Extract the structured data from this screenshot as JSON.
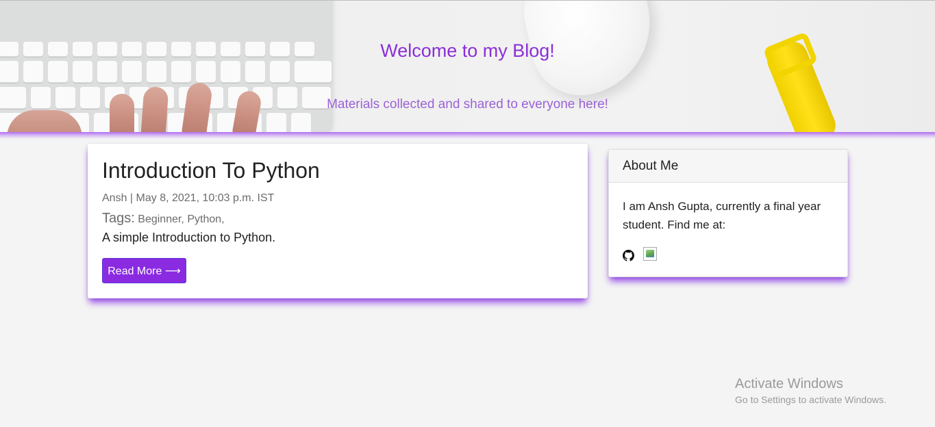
{
  "header": {
    "title": "Welcome to my Blog!",
    "subtitle": "Materials collected and shared to everyone here!",
    "accent_color": "#8a2fd6"
  },
  "post": {
    "title": "Introduction To Python",
    "meta": "Ansh | May 8, 2021, 10:03 p.m. IST",
    "tags_label": "Tags:",
    "tags": [
      "Beginner,",
      "Python,"
    ],
    "excerpt": "A simple Introduction to Python.",
    "read_more_label": "Read More ⟶",
    "button_color": "#8a2be2"
  },
  "about": {
    "heading": "About Me",
    "text": "I am Ansh Gupta, currently a final year student. Find me at:",
    "social_icons": [
      "github-icon",
      "broken-image-icon"
    ]
  },
  "watermark": {
    "title": "Activate Windows",
    "subtitle": "Go to Settings to activate Windows."
  }
}
